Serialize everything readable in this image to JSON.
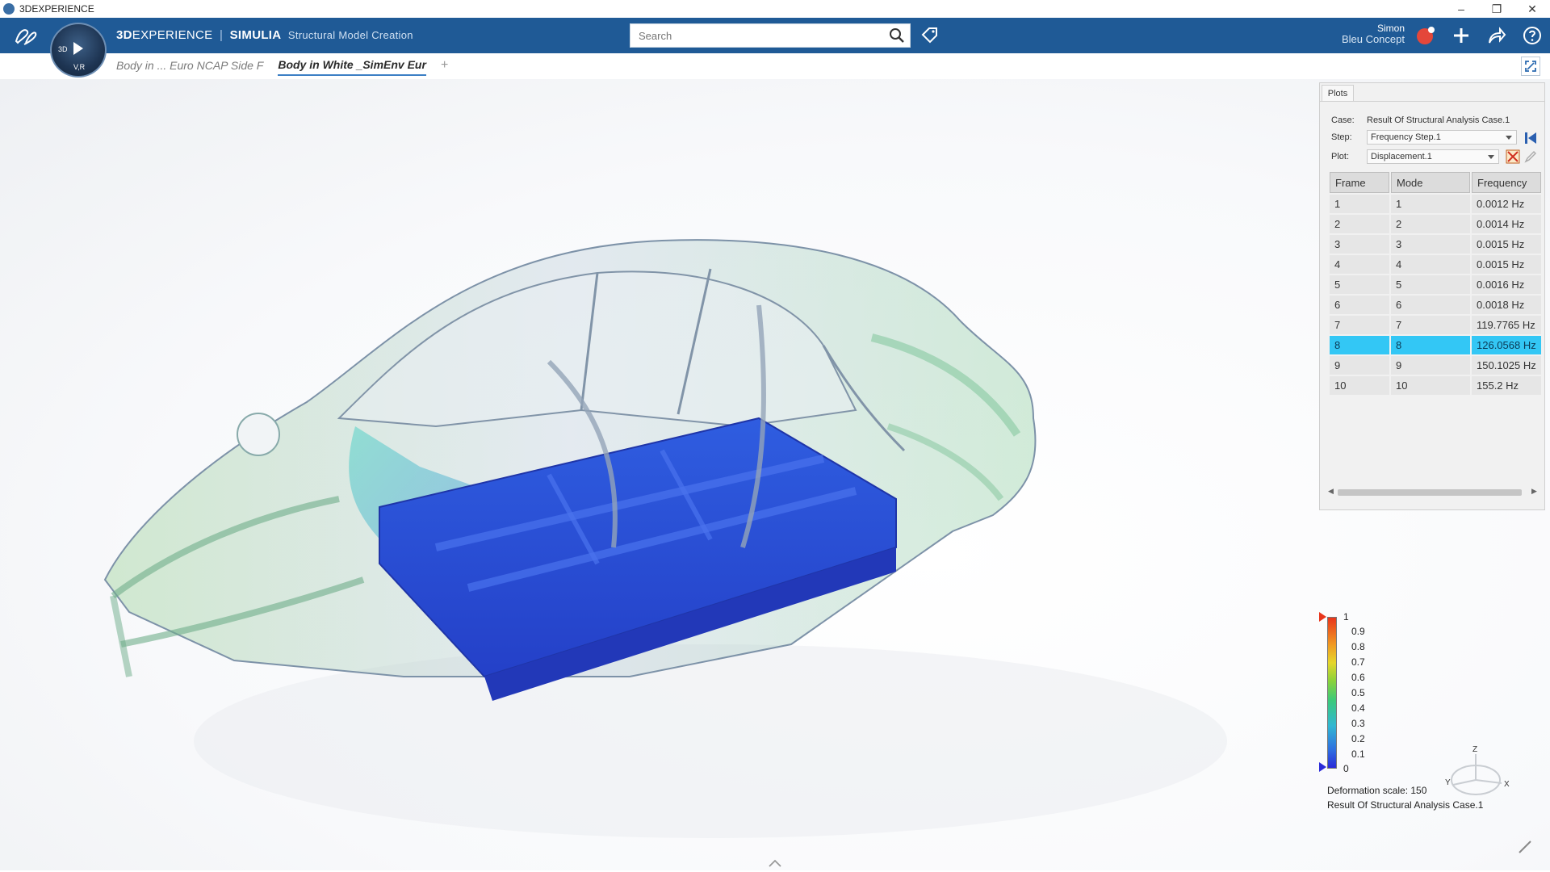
{
  "window": {
    "title": "3DEXPERIENCE"
  },
  "app": {
    "brand_prefix": "3D",
    "brand_rest": "EXPERIENCE",
    "separator": "|",
    "product": "SIMULIA",
    "app_name": "Structural Model Creation"
  },
  "compass": {
    "top": "3D",
    "bottom": "V,R"
  },
  "search": {
    "placeholder": "Search",
    "value": ""
  },
  "user": {
    "name": "Simon",
    "org": "Bleu Concept"
  },
  "tabs": [
    {
      "label": "Body in ... Euro NCAP Side F",
      "active": false
    },
    {
      "label": "Body in White _SimEnv Eur",
      "active": true
    }
  ],
  "tab_add": "+",
  "plots": {
    "tab": "Plots",
    "case_label": "Case:",
    "case_value": "Result Of Structural Analysis Case.1",
    "step_label": "Step:",
    "step_value": "Frequency Step.1",
    "plot_label": "Plot:",
    "plot_value": "Displacement.1",
    "columns": [
      "Frame",
      "Mode",
      "Frequency"
    ],
    "rows": [
      {
        "frame": "1",
        "mode": "1",
        "freq": "0.0012 Hz"
      },
      {
        "frame": "2",
        "mode": "2",
        "freq": "0.0014 Hz"
      },
      {
        "frame": "3",
        "mode": "3",
        "freq": "0.0015 Hz"
      },
      {
        "frame": "4",
        "mode": "4",
        "freq": "0.0015 Hz"
      },
      {
        "frame": "5",
        "mode": "5",
        "freq": "0.0016 Hz"
      },
      {
        "frame": "6",
        "mode": "6",
        "freq": "0.0018 Hz"
      },
      {
        "frame": "7",
        "mode": "7",
        "freq": "119.7765 Hz"
      },
      {
        "frame": "8",
        "mode": "8",
        "freq": "126.0568 Hz"
      },
      {
        "frame": "9",
        "mode": "9",
        "freq": "150.1025 Hz"
      },
      {
        "frame": "10",
        "mode": "10",
        "freq": "155.2 Hz"
      }
    ],
    "selected_frame": "8"
  },
  "legend": {
    "ticks": [
      "1",
      "0.9",
      "0.8",
      "0.7",
      "0.6",
      "0.5",
      "0.4",
      "0.3",
      "0.2",
      "0.1",
      "0"
    ],
    "deformation": "Deformation scale: 150",
    "result_name": "Result Of Structural Analysis Case.1"
  },
  "axes": {
    "x": "X",
    "y": "Y",
    "z": "Z"
  },
  "colors": {
    "app_bar": "#1f5a96",
    "selection": "#33c7f5",
    "floor_blue": "#2a4fd8"
  }
}
